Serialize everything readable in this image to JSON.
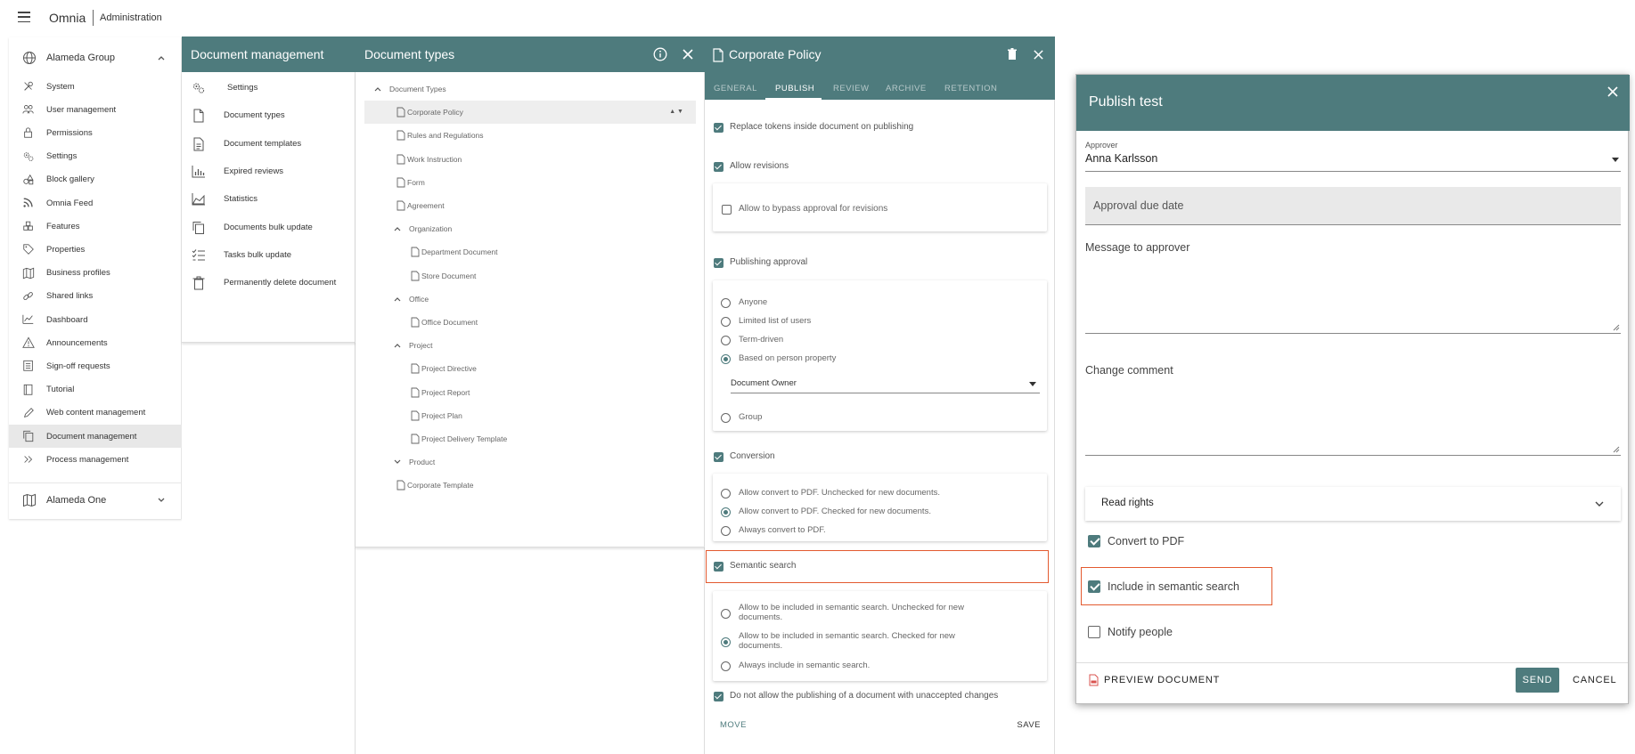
{
  "topbar": {
    "brand": "Omnia",
    "section": "Administration"
  },
  "leftnav": {
    "group1": "Alameda Group",
    "items": [
      {
        "label": "System",
        "icon": "tools-icon"
      },
      {
        "label": "User management",
        "icon": "users-icon"
      },
      {
        "label": "Permissions",
        "icon": "lock-icon"
      },
      {
        "label": "Settings",
        "icon": "gears-icon"
      },
      {
        "label": "Block gallery",
        "icon": "shapes-icon"
      },
      {
        "label": "Omnia Feed",
        "icon": "rss-icon"
      },
      {
        "label": "Features",
        "icon": "cubes-icon"
      },
      {
        "label": "Properties",
        "icon": "tag-icon"
      },
      {
        "label": "Business profiles",
        "icon": "map-icon"
      },
      {
        "label": "Shared links",
        "icon": "link-icon"
      },
      {
        "label": "Dashboard",
        "icon": "chart-icon"
      },
      {
        "label": "Announcements",
        "icon": "warning-icon"
      },
      {
        "label": "Sign-off requests",
        "icon": "list-icon"
      },
      {
        "label": "Tutorial",
        "icon": "book-icon"
      },
      {
        "label": "Web content management",
        "icon": "pen-icon"
      },
      {
        "label": "Document management",
        "icon": "copy-icon"
      },
      {
        "label": "Process management",
        "icon": "double-chevron-icon"
      }
    ],
    "group2": "Alameda One"
  },
  "docmgmt": {
    "title": "Document management",
    "items": [
      {
        "label": "Settings",
        "icon": "gears-icon"
      },
      {
        "label": "Document types",
        "icon": "file-icon"
      },
      {
        "label": "Document templates",
        "icon": "file-text-icon"
      },
      {
        "label": "Expired reviews",
        "icon": "bar-chart-icon"
      },
      {
        "label": "Statistics",
        "icon": "area-chart-icon"
      },
      {
        "label": "Documents bulk update",
        "icon": "copy-icon"
      },
      {
        "label": "Tasks bulk update",
        "icon": "tasks-icon"
      },
      {
        "label": "Permanently delete document",
        "icon": "trash-icon"
      }
    ]
  },
  "doctypes": {
    "title": "Document types",
    "tree": [
      {
        "label": "Document Types",
        "level": 0,
        "kind": "folder"
      },
      {
        "label": "Corporate Policy",
        "level": 1,
        "kind": "doc",
        "selected": true
      },
      {
        "label": "Rules and Regulations",
        "level": 1,
        "kind": "doc"
      },
      {
        "label": "Work Instruction",
        "level": 1,
        "kind": "doc"
      },
      {
        "label": "Form",
        "level": 1,
        "kind": "doc"
      },
      {
        "label": "Agreement",
        "level": 1,
        "kind": "doc"
      },
      {
        "label": "Organization",
        "level": 1,
        "kind": "folder"
      },
      {
        "label": "Department Document",
        "level": 2,
        "kind": "doc"
      },
      {
        "label": "Store Document",
        "level": 2,
        "kind": "doc"
      },
      {
        "label": "Office",
        "level": 1,
        "kind": "folder"
      },
      {
        "label": "Office Document",
        "level": 2,
        "kind": "doc"
      },
      {
        "label": "Project",
        "level": 1,
        "kind": "folder"
      },
      {
        "label": "Project Directive",
        "level": 2,
        "kind": "doc"
      },
      {
        "label": "Project Report",
        "level": 2,
        "kind": "doc"
      },
      {
        "label": "Project Plan",
        "level": 2,
        "kind": "doc"
      },
      {
        "label": "Project Delivery Template",
        "level": 2,
        "kind": "doc"
      },
      {
        "label": "Product",
        "level": 1,
        "kind": "folder"
      },
      {
        "label": "Corporate Template",
        "level": 1,
        "kind": "doc"
      }
    ]
  },
  "policy": {
    "title": "Corporate Policy",
    "tabs": [
      "GENERAL",
      "PUBLISH",
      "REVIEW",
      "ARCHIVE",
      "RETENTION"
    ],
    "active_tab": "PUBLISH",
    "replace_tokens": "Replace tokens inside document on publishing",
    "allow_revisions": "Allow revisions",
    "bypass_approval": "Allow to bypass approval for revisions",
    "publishing_approval": "Publishing approval",
    "approval_options": [
      "Anyone",
      "Limited list of users",
      "Term-driven",
      "Based on person property"
    ],
    "person_property": "Document Owner",
    "group_option": "Group",
    "conversion": "Conversion",
    "conversion_options": [
      "Allow convert to PDF. Unchecked for new documents.",
      "Allow convert to PDF. Checked for new documents.",
      "Always convert to PDF."
    ],
    "semantic_search": "Semantic search",
    "semantic_options": [
      {
        "line1": "Allow to be included in semantic search. Unchecked for new",
        "line2": "documents."
      },
      {
        "line1": "Allow to be included in semantic search. Checked for new",
        "line2": "documents."
      },
      {
        "line1": "Always include in semantic search.",
        "line2": ""
      }
    ],
    "no_unaccepted": "Do not allow the publishing of a document with unaccepted changes",
    "move": "MOVE",
    "save": "SAVE",
    "colors": {
      "header": "#4e7b7d",
      "highlight": "#e35a2f"
    }
  },
  "publish_dialog": {
    "title": "Publish test",
    "approver_label": "Approver",
    "approver_value": "Anna Karlsson",
    "due_date_placeholder": "Approval due date",
    "message_label": "Message to approver",
    "change_comment_label": "Change comment",
    "read_rights": "Read rights",
    "convert_pdf": "Convert to PDF",
    "semantic": "Include in semantic search",
    "notify": "Notify people",
    "preview": "PREVIEW DOCUMENT",
    "send": "SEND",
    "cancel": "CANCEL"
  }
}
